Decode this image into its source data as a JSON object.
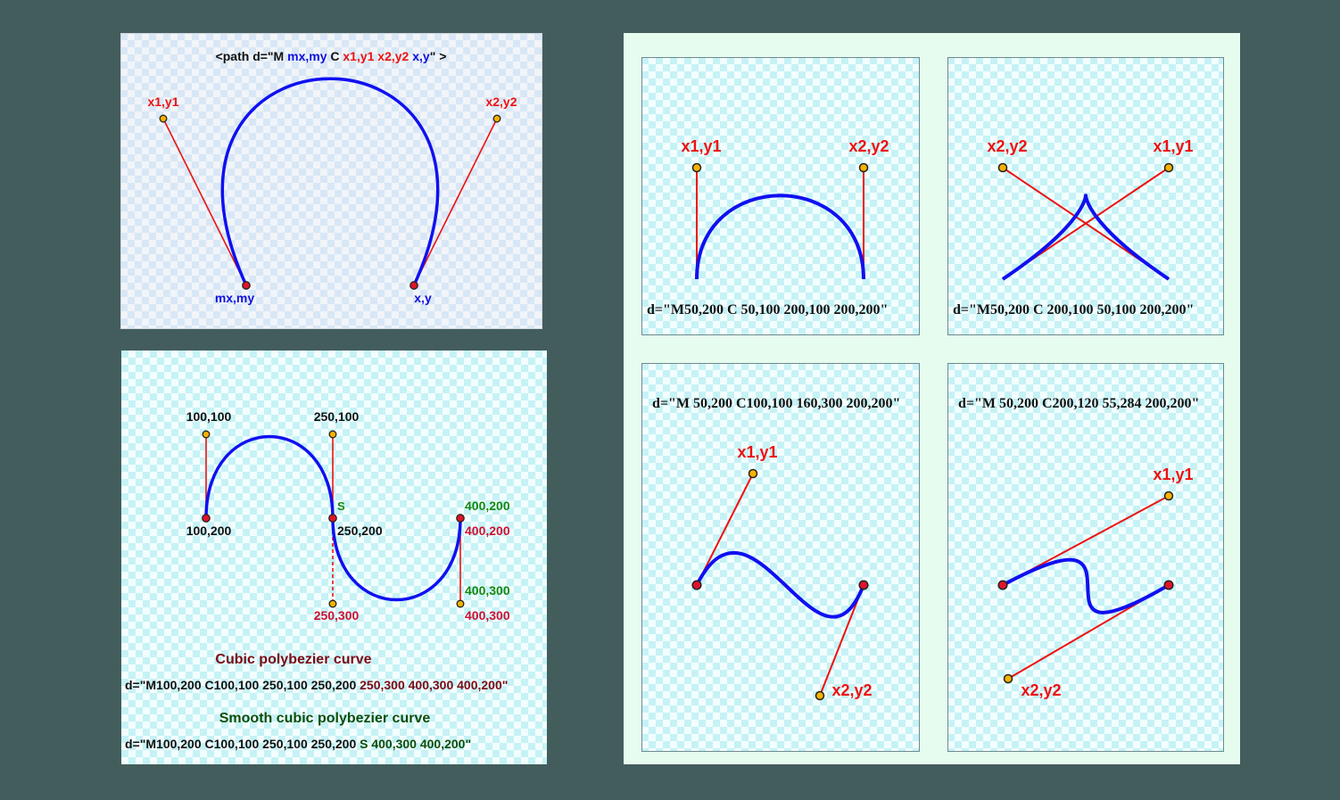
{
  "colors": {
    "page_bg": "#435d5d",
    "curve": "#1010f0",
    "control_line": "#ee1111",
    "control_dot_fill": "#f7b100",
    "end_dot_fill": "#e0142b",
    "label_red": "#ee1111",
    "label_blue": "#1010e0",
    "label_green": "#118811",
    "label_crimson": "#cc1133",
    "heading_maroon": "#7a0a14",
    "heading_green": "#0a4d0a"
  },
  "anatomy": {
    "syntax_prefix": "<path d=\"M ",
    "syntax_move": "mx,my",
    "syntax_c": " C ",
    "syntax_cp": "x1,y1 x2,y2",
    "syntax_end": "x,y",
    "syntax_suffix": "\" >",
    "label_cp1": "x1,y1",
    "label_cp2": "x2,y2",
    "label_start": "mx,my",
    "label_end": "x,y"
  },
  "poly": {
    "label_cp1": "100,100",
    "label_cp2": "250,100",
    "label_p0": "100,200",
    "label_p1": "250,200",
    "label_s": "S",
    "label_cp3": "250,300",
    "label_cp4_green": "400,300",
    "label_cp4_red": "400,300",
    "label_p2_green": "400,200",
    "label_p2_red": "400,200",
    "cubic_title": "Cubic polybezier curve",
    "cubic_code_black": "d=\"M100,200 C100,100 250,100 250,200 ",
    "cubic_code_colored": "250,300 400,300 400,200\"",
    "smooth_title": "Smooth cubic polybezier curve",
    "smooth_code_black": "d=\"M100,200 C100,100 250,100 250,200 ",
    "smooth_code_colored": "S 400,300 400,200\""
  },
  "examples": [
    {
      "label_a": "x1,y1",
      "label_b": "x2,y2",
      "code": "d=\"M50,200 C 50,100 200,100 200,200\""
    },
    {
      "label_a": "x2,y2",
      "label_b": "x1,y1",
      "code": "d=\"M50,200 C 200,100 50,100 200,200\""
    },
    {
      "label_a": "x1,y1",
      "label_b": "x2,y2",
      "code": "d=\"M 50,200 C100,100 160,300 200,200\""
    },
    {
      "label_a": "x1,y1",
      "label_b": "x2,y2",
      "code": "d=\"M 50,200 C200,120 55,284 200,200\""
    }
  ]
}
